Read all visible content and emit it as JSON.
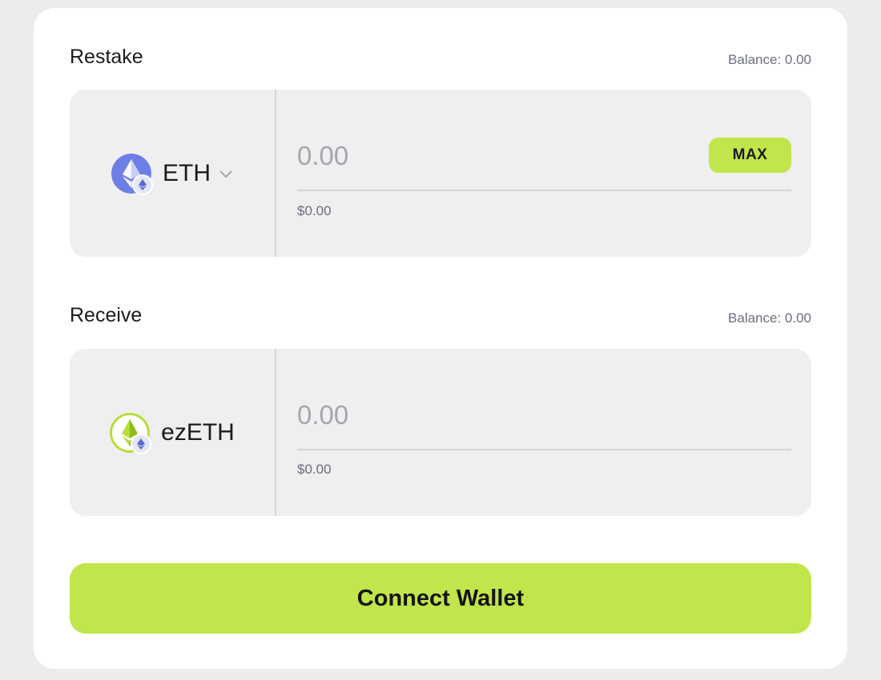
{
  "restake": {
    "label": "Restake",
    "balance": "Balance: 0.00",
    "token": {
      "name": "ETH",
      "icon": "eth-icon",
      "badge_icon": "eth-icon",
      "color": "#6d7ee6"
    },
    "amount_placeholder": "0.00",
    "usd_value": "$0.00",
    "max_label": "MAX"
  },
  "receive": {
    "label": "Receive",
    "balance": "Balance: 0.00",
    "token": {
      "name": "ezETH",
      "icon": "ezeth-icon",
      "badge_icon": "eth-icon",
      "color": "#b6dd3a"
    },
    "amount_placeholder": "0.00",
    "usd_value": "$0.00"
  },
  "connect_wallet_label": "Connect Wallet",
  "colors": {
    "accent": "#c1e64c",
    "panel": "#efefef",
    "page_background": "#ececec",
    "muted_text": "#6b6f7a"
  }
}
